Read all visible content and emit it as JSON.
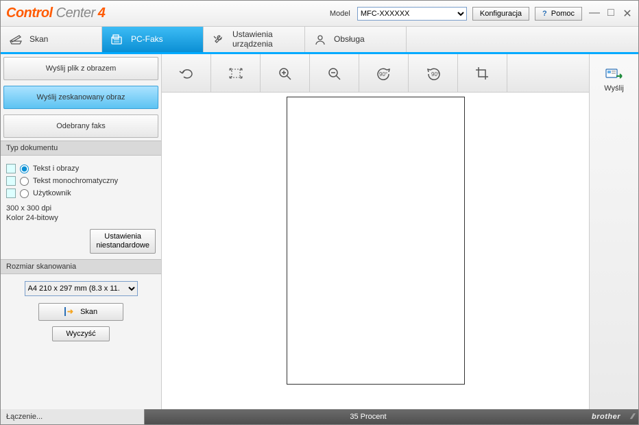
{
  "title": {
    "brand1": "Control",
    "brand2": " Center",
    "num": "4"
  },
  "header": {
    "model_label": "Model",
    "model_value": "MFC-XXXXXX",
    "config_button": "Konfiguracja",
    "help_button": "Pomoc"
  },
  "tabs": {
    "skan": "Skan",
    "pcfax": "PC-Faks",
    "ustawienia_l1": "Ustawienia",
    "ustawienia_l2": "urządzenia",
    "obsluga": "Obsługa"
  },
  "modes": {
    "send_image_file": "Wyślij plik z obrazem",
    "send_scanned_image": "Wyślij zeskanowany obraz",
    "received_fax": "Odebrany faks"
  },
  "doc_type": {
    "header": "Typ dokumentu",
    "opt_text_images": "Tekst i obrazy",
    "opt_mono": "Tekst monochromatyczny",
    "opt_user": "Użytkownik",
    "meta_line1": "300 x 300 dpi",
    "meta_line2": "Kolor 24-bitowy",
    "custom_btn_l1": "Ustawienia",
    "custom_btn_l2": "niestandardowe"
  },
  "scan_size": {
    "header": "Rozmiar skanowania",
    "value": "A4 210 x 297 mm (8.3 x 11.",
    "scan_btn": "Skan",
    "clear_btn": "Wyczyść"
  },
  "right": {
    "send": "Wyślij"
  },
  "status": {
    "left": "Łączenie...",
    "center": "35 Procent",
    "brand": "brother"
  },
  "toolbar_icons": {
    "undo": "undo-icon",
    "fit": "fit-screen-icon",
    "zoom_in": "zoom-in-icon",
    "zoom_out": "zoom-out-icon",
    "rotate_ccw": "rotate-ccw-icon",
    "rotate_cw": "rotate-cw-icon",
    "crop": "crop-icon"
  }
}
